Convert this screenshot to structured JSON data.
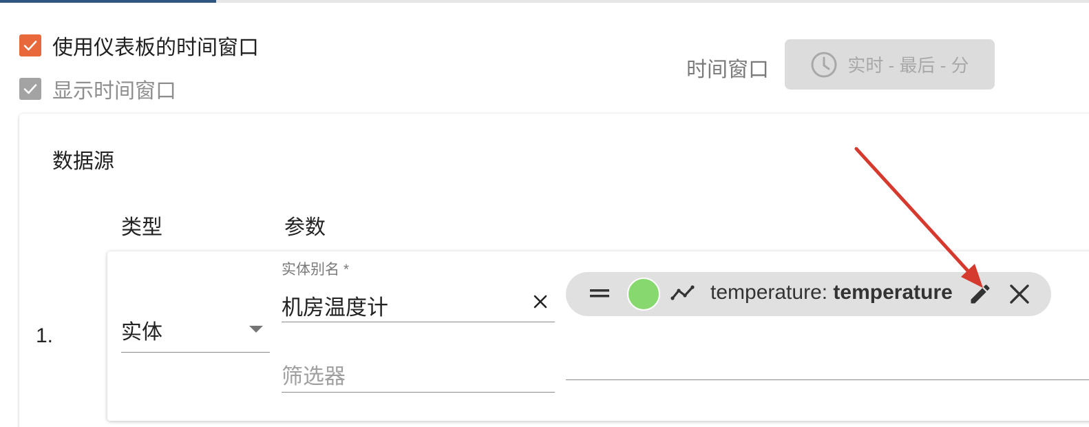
{
  "options": {
    "use_dashboard_timewindow": {
      "label": "使用仪表板的时间窗口",
      "checked": true
    },
    "display_timewindow": {
      "label": "显示时间窗口",
      "checked": true,
      "disabled": true
    }
  },
  "timewindow": {
    "label": "时间窗口",
    "button_text": "实时 - 最后 - 分",
    "icon": "clock-icon"
  },
  "datasources": {
    "title": "数据源",
    "columns": {
      "type": "类型",
      "params": "参数"
    },
    "rows": [
      {
        "index": "1.",
        "type_value": "实体",
        "alias_label": "实体别名 *",
        "alias_value": "机房温度计",
        "filter_placeholder": "筛选器",
        "keys": [
          {
            "color": "#87d96f",
            "key_name": "temperature",
            "separator": ": ",
            "key_label": "temperature",
            "type_icon": "timeseries-trend-icon"
          }
        ]
      }
    ]
  },
  "colors": {
    "accent": "#e8673b",
    "primary": "#305680",
    "annotation": "#d63a2e"
  }
}
